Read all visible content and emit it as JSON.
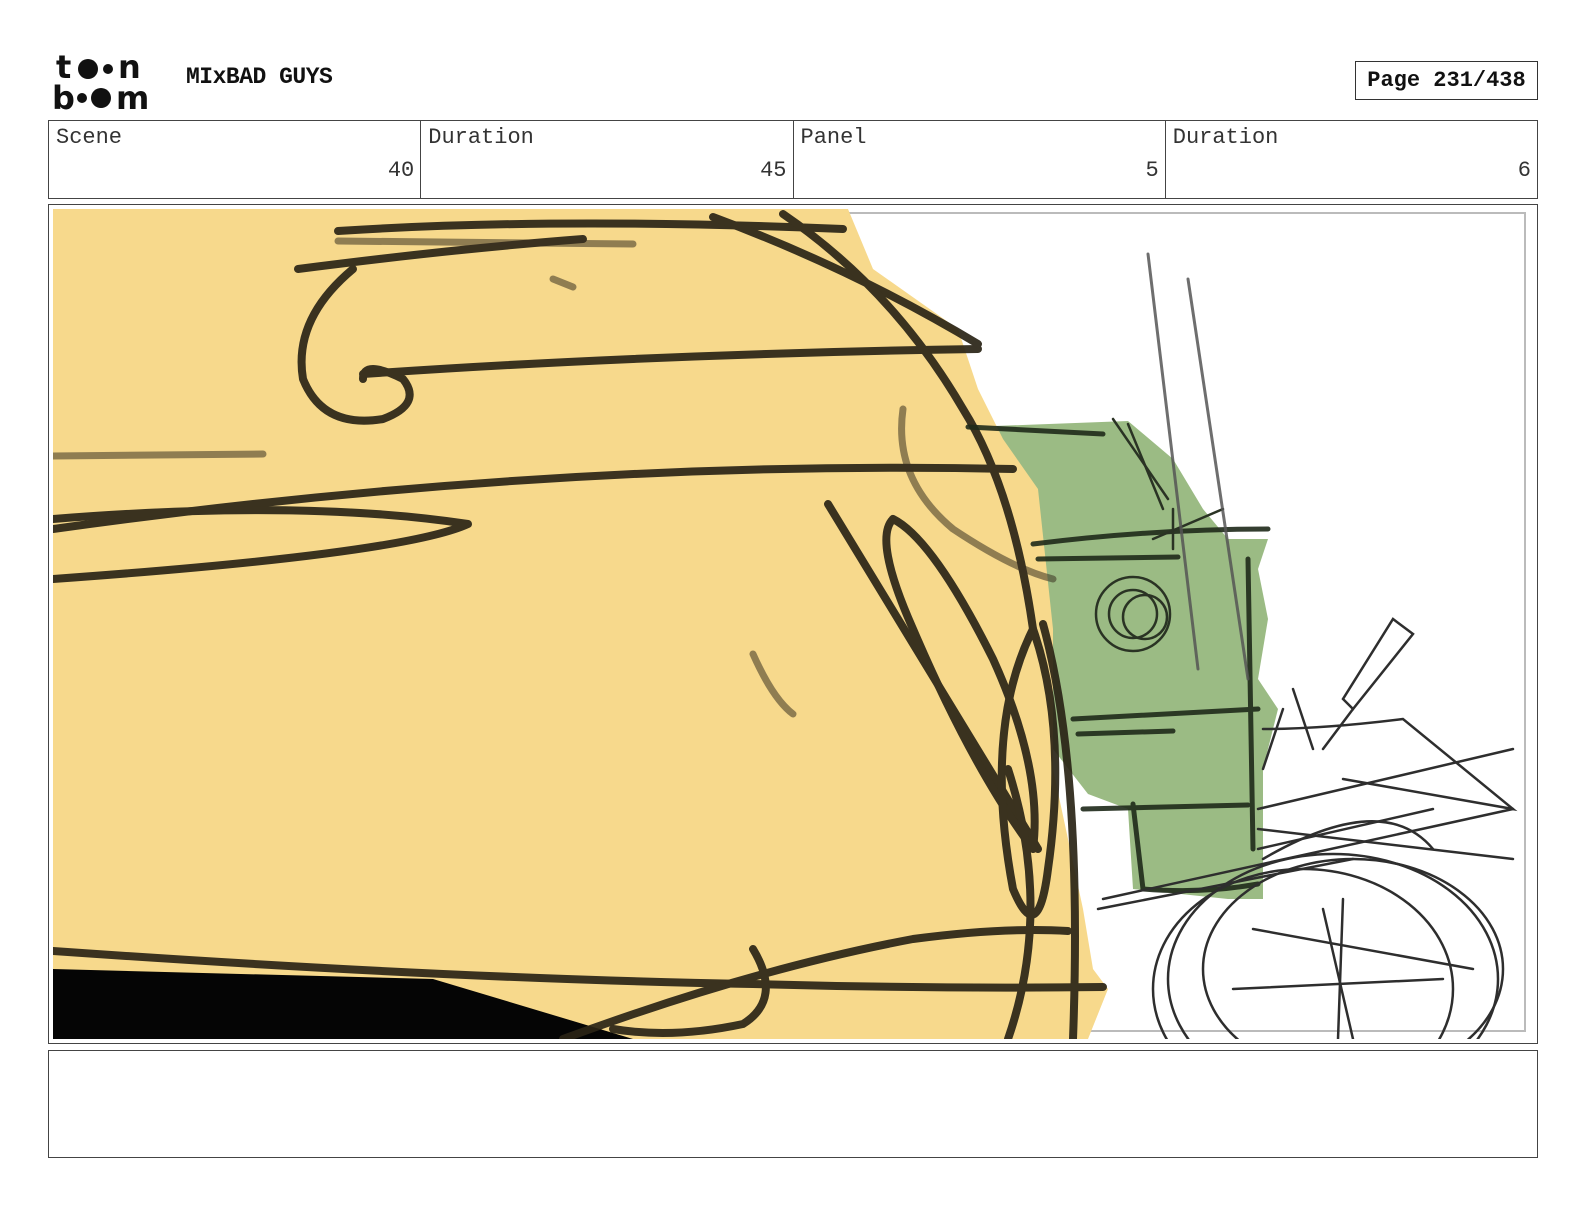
{
  "header": {
    "logo_top": "t  n",
    "logo_bottom": "b  m",
    "project_title": "MIxBAD GUYS",
    "page_label": "Page 231/438"
  },
  "info": {
    "scene_label": "Scene",
    "scene_value": "40",
    "scene_duration_label": "Duration",
    "scene_duration_value": "45",
    "panel_label": "Panel",
    "panel_value": "5",
    "panel_duration_label": "Duration",
    "panel_duration_value": "6"
  },
  "notes": {
    "text": ""
  },
  "colors": {
    "skin": "#f7d98c",
    "green": "#9bbb84",
    "ink": "#2a2416",
    "sketch": "#3a3a3a"
  }
}
